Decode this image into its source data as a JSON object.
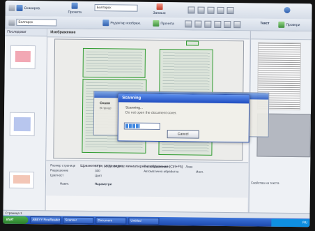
{
  "toolbar1": {
    "scan_label": "Сканиров.",
    "read_label": "Прочита",
    "language_value": "Болгарск",
    "save_label": "Запиши"
  },
  "toolbar2": {
    "language_value": "Болгарск"
  },
  "left_panel": {
    "header": "Последоват"
  },
  "center": {
    "header": "Изображение",
    "editor_button": "Редактир изображ.",
    "read_button": "Прочита"
  },
  "right_panel": {
    "header": "Текст",
    "check_button": "Провери"
  },
  "back_dialog": {
    "text1": "Скани",
    "text2": "В проце"
  },
  "scan_dialog": {
    "title": "Scanning",
    "message1": "Scanning...",
    "message2": "Do not open the document cover.",
    "progress": 0.45,
    "cancel_label": "Cancel"
  },
  "props": {
    "p1": "Размер страници",
    "p1v": "897 × 1306 пиксела",
    "p2": "Разрешение",
    "p2v": "300",
    "p3": "Цветност",
    "p3v": "Цвят",
    "p4": "Тип изображение",
    "p4v": "Ляво",
    "p5": "Автоматична обработка",
    "p5v": "Изкл.",
    "tab1": "Навиг.",
    "tab2": "Параметри",
    "right1": "Свойства на текста"
  },
  "hint": "Щракнете тук, за да видите миниатюрни изображения (Ctrl+F5)",
  "status": "Страница 1",
  "taskbar": {
    "start": "start",
    "tasks": [
      "ABBYY FineReader",
      "Scanner",
      "Document",
      "Untitled"
    ],
    "tray": "RU"
  }
}
